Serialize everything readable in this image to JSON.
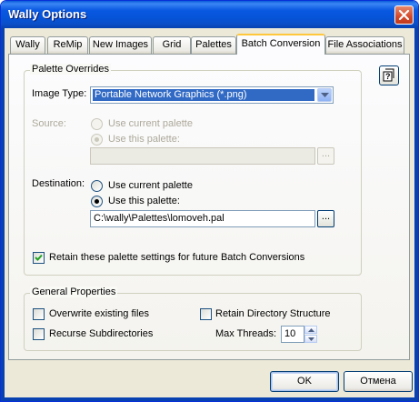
{
  "window": {
    "title": "Wally Options"
  },
  "tabs": [
    {
      "label": "Wally"
    },
    {
      "label": "ReMip"
    },
    {
      "label": "New Images"
    },
    {
      "label": "Grid"
    },
    {
      "label": "Palettes"
    },
    {
      "label": "Batch Conversion"
    },
    {
      "label": "File Associations"
    }
  ],
  "palette_overrides": {
    "title": "Palette Overrides",
    "image_type_label": "Image Type:",
    "image_type_value": "Portable Network Graphics (*.png)",
    "source_label": "Source:",
    "source_current": "Use current palette",
    "source_this": "Use this palette:",
    "source_path": "",
    "destination_label": "Destination:",
    "dest_current": "Use current palette",
    "dest_this": "Use this palette:",
    "dest_path": "C:\\wally\\Palettes\\lomoveh.pal",
    "browse_label": "...",
    "retain_label": "Retain these palette settings for future Batch Conversions"
  },
  "general": {
    "title": "General Properties",
    "overwrite_label": "Overwrite existing files",
    "recurse_label": "Recurse Subdirectories",
    "retain_dir_label": "Retain Directory Structure",
    "max_threads_label": "Max Threads:",
    "max_threads_value": "10"
  },
  "buttons": {
    "ok": "OK",
    "cancel": "Отмена"
  },
  "colors": {
    "title_bar": "#0554d9",
    "selection": "#316ac5",
    "tab_highlight": "#ffc83c"
  },
  "icons": [
    "close-icon",
    "help-icon",
    "dropdown-arrow-icon",
    "checkmark-icon",
    "mouse-cursor-icon"
  ]
}
